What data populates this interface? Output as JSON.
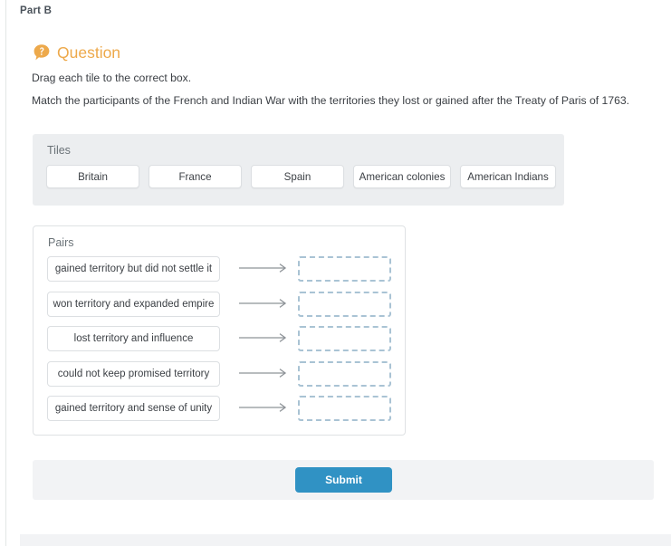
{
  "part": {
    "label": "Part B"
  },
  "question": {
    "icon": "question-mark-bubble-icon",
    "heading": "Question",
    "instruction": "Drag each tile to the correct box.",
    "prompt": "Match the participants of the French and Indian War with the territories they lost or gained after the Treaty of Paris of 1763."
  },
  "tiles": {
    "label": "Tiles",
    "items": [
      {
        "label": "Britain"
      },
      {
        "label": "France"
      },
      {
        "label": "Spain"
      },
      {
        "label": "American colonies"
      },
      {
        "label": "American Indians"
      }
    ]
  },
  "pairs": {
    "label": "Pairs",
    "rows": [
      {
        "label": "gained territory but did not settle it",
        "arrow": "arrow-right-icon",
        "drop_value": ""
      },
      {
        "label": "won territory and expanded empire",
        "arrow": "arrow-right-icon",
        "drop_value": ""
      },
      {
        "label": "lost territory and influence",
        "arrow": "arrow-right-icon",
        "drop_value": ""
      },
      {
        "label": "could not keep promised territory",
        "arrow": "arrow-right-icon",
        "drop_value": ""
      },
      {
        "label": "gained territory and sense of unity",
        "arrow": "arrow-right-icon",
        "drop_value": ""
      }
    ]
  },
  "footer": {
    "submit_label": "Submit"
  },
  "colors": {
    "question_accent": "#eda94b",
    "submit_blue": "#3092c4",
    "panel_gray": "#eceef0",
    "dropzone_border": "#a9c3d4",
    "text_dark": "#3b3f44",
    "text_muted": "#6b7378"
  }
}
